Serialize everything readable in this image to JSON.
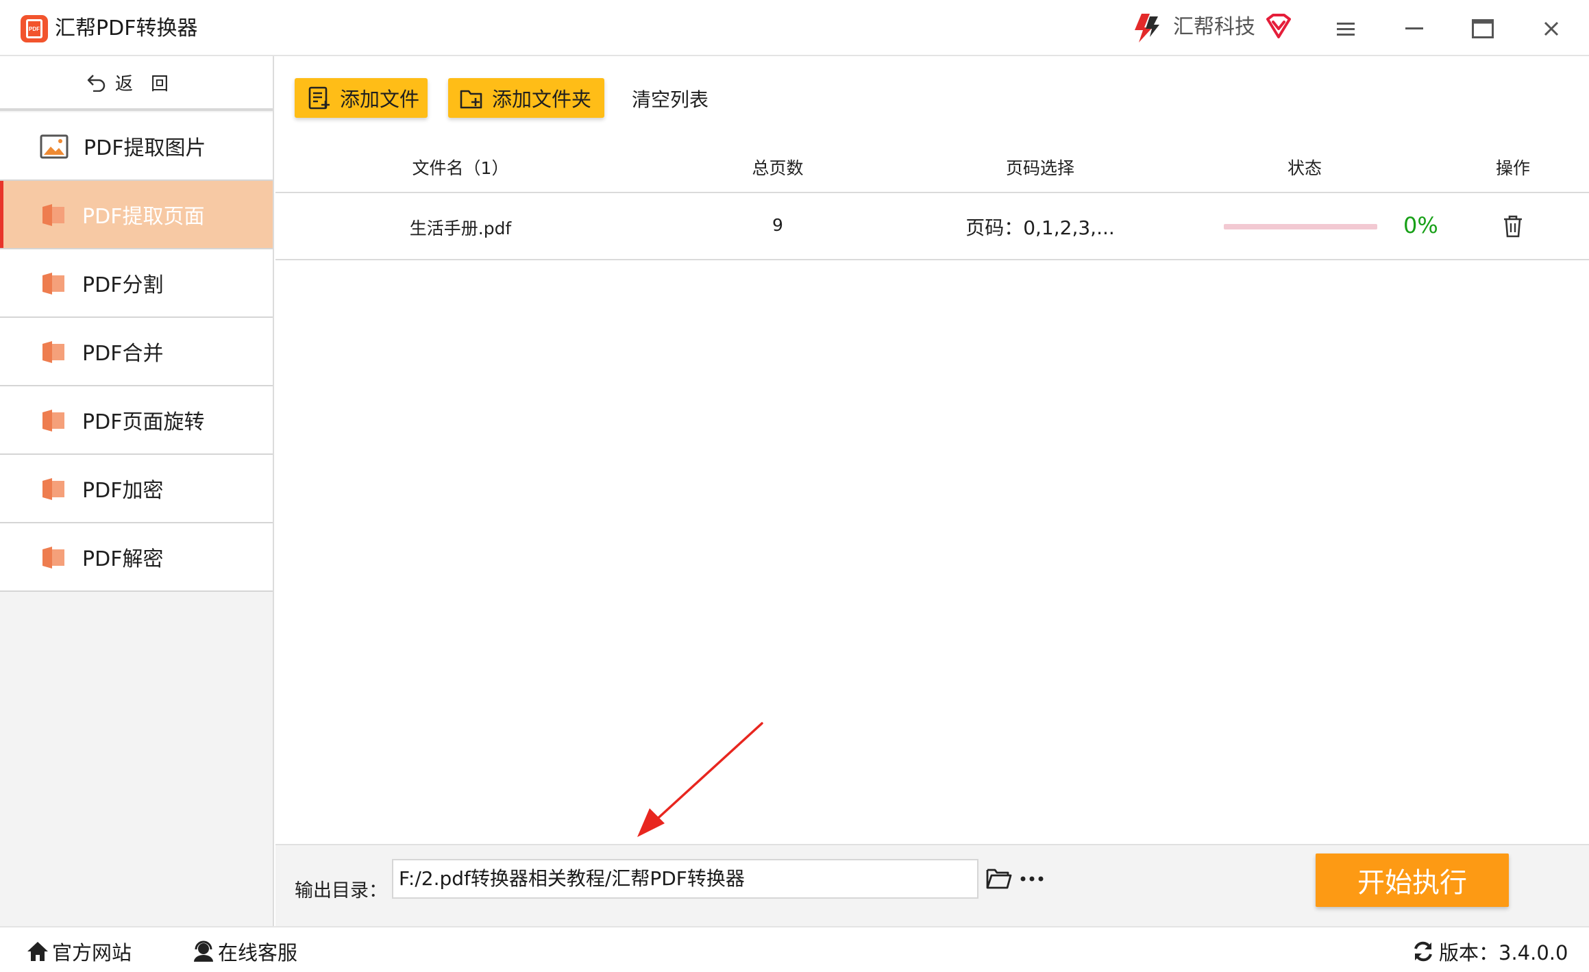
{
  "window": {
    "title": "汇帮PDF转换器",
    "logo_text": "PDF",
    "brand_name": "汇帮科技",
    "controls": [
      "menu-icon",
      "minimize-icon",
      "maximize-icon",
      "close-icon"
    ]
  },
  "sidebar": {
    "back_label": "返回",
    "items": [
      {
        "label": "PDF提取图片",
        "icon": "image-icon",
        "active": false
      },
      {
        "label": "PDF提取页面",
        "icon": "pdf-doc-icon",
        "active": true
      },
      {
        "label": "PDF分割",
        "icon": "pdf-doc-icon",
        "active": false
      },
      {
        "label": "PDF合并",
        "icon": "pdf-doc-icon",
        "active": false
      },
      {
        "label": "PDF页面旋转",
        "icon": "pdf-doc-icon",
        "active": false
      },
      {
        "label": "PDF加密",
        "icon": "pdf-doc-icon",
        "active": false
      },
      {
        "label": "PDF解密",
        "icon": "pdf-doc-icon",
        "active": false
      }
    ]
  },
  "toolbar": {
    "add_file": "添加文件",
    "add_folder": "添加文件夹",
    "clear_list": "清空列表"
  },
  "table": {
    "columns": [
      "文件名（1）",
      "总页数",
      "页码选择",
      "状态",
      "操作"
    ],
    "rows": [
      {
        "filename": "生活手册.pdf",
        "total_pages": "9",
        "page_selection": "页码：0,1,2,3,...",
        "progress": 0,
        "progress_text": "0%"
      }
    ]
  },
  "output": {
    "label": "输出目录：",
    "path": "F:/2.pdf转换器相关教程/汇帮PDF转换器",
    "more": "···",
    "start_button": "开始执行"
  },
  "statusbar": {
    "website": "官方网站",
    "support": "在线客服",
    "version": "版本：3.4.0.0"
  },
  "colors": {
    "accent_yellow": "#ffbd17",
    "start_orange": "#fd9a14",
    "active_item_bg": "#f7c9a4",
    "active_marker": "#e8352b",
    "progress_text": "#18a018",
    "pdf_icon": "#ee7d4f"
  }
}
